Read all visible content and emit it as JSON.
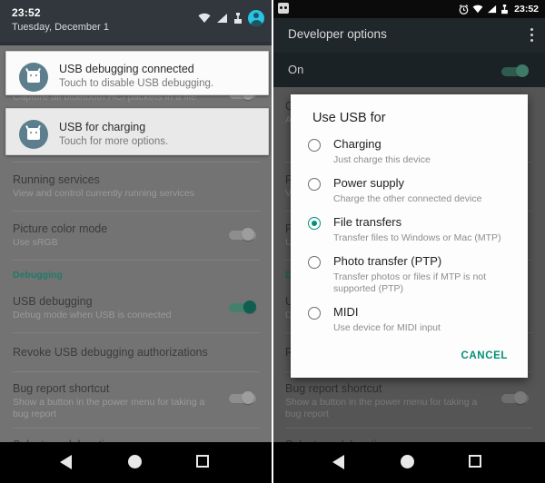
{
  "left": {
    "statusbar": {
      "time": "23:52",
      "date": "Tuesday, December 1",
      "icons": [
        "wifi-icon",
        "signal-icon",
        "usb-icon",
        "user-avatar-icon"
      ]
    },
    "notifications": [
      {
        "icon": "android-debug-icon",
        "title": "USB debugging connected",
        "subtitle": "Touch to disable USB debugging."
      },
      {
        "icon": "android-usb-icon",
        "title": "USB for charging",
        "subtitle": "Touch for more options."
      }
    ],
    "behind_rows": [
      {
        "title": "Capture all bluetooth HCI packets in a file",
        "sub": "",
        "toggle": "off"
      }
    ],
    "rows": [
      {
        "title": "Running services",
        "sub": "View and control currently running services",
        "toggle": null
      },
      {
        "title": "Picture color mode",
        "sub": "Use sRGB",
        "toggle": "off"
      },
      {
        "section": "Debugging"
      },
      {
        "title": "USB debugging",
        "sub": "Debug mode when USB is connected",
        "toggle": "on"
      },
      {
        "title": "Revoke USB debugging authorizations",
        "sub": "",
        "toggle": null
      },
      {
        "title": "Bug report shortcut",
        "sub": "Show a button in the power menu for taking a bug report",
        "toggle": "off"
      },
      {
        "title": "Select mock location app",
        "sub": "",
        "toggle": null
      }
    ],
    "navbar": [
      "back-icon",
      "home-icon",
      "recents-icon"
    ]
  },
  "right": {
    "statusbar": {
      "time": "23:52",
      "icons": [
        "android-debug-icon",
        "alarm-icon",
        "wifi-icon",
        "signal-icon",
        "usb-icon"
      ]
    },
    "actionbar": {
      "title": "Developer options",
      "overflow": "overflow-menu-icon"
    },
    "master_switch": {
      "label": "On",
      "state": "on"
    },
    "behind_rows": [
      {
        "title": "Open...",
        "sub": "A..."
      },
      {
        "title": "Running services",
        "sub": "View and control currently running services"
      },
      {
        "title": "Picture color mode",
        "sub": "Use sRGB"
      },
      {
        "section": "Debugging"
      },
      {
        "title": "USB debugging",
        "sub": "Debug mode when USB is connected"
      },
      {
        "title": "Revoke USB debugging authorizations",
        "sub": ""
      }
    ],
    "rows": [
      {
        "title": "Bug report shortcut",
        "sub": "Show a button in the power menu for taking a bug report",
        "toggle": "off"
      },
      {
        "title": "Select mock location app",
        "sub": "",
        "toggle": null
      }
    ],
    "dialog": {
      "title": "Use USB for",
      "options": [
        {
          "label": "Charging",
          "desc": "Just charge this device",
          "selected": false
        },
        {
          "label": "Power supply",
          "desc": "Charge the other connected device",
          "selected": false
        },
        {
          "label": "File transfers",
          "desc": "Transfer files to Windows or Mac (MTP)",
          "selected": true
        },
        {
          "label": "Photo transfer (PTP)",
          "desc": "Transfer photos or files if MTP is not supported (PTP)",
          "selected": false
        },
        {
          "label": "MIDI",
          "desc": "Use device for MIDI input",
          "selected": false
        }
      ],
      "cancel_label": "CANCEL"
    },
    "navbar": [
      "back-icon",
      "home-icon",
      "recents-icon"
    ]
  },
  "colors": {
    "accent_teal": "#009078",
    "statusbar_left": "#31373d",
    "statusbar_right": "#0b0b0b",
    "avatar_cyan": "#27c4e6"
  }
}
